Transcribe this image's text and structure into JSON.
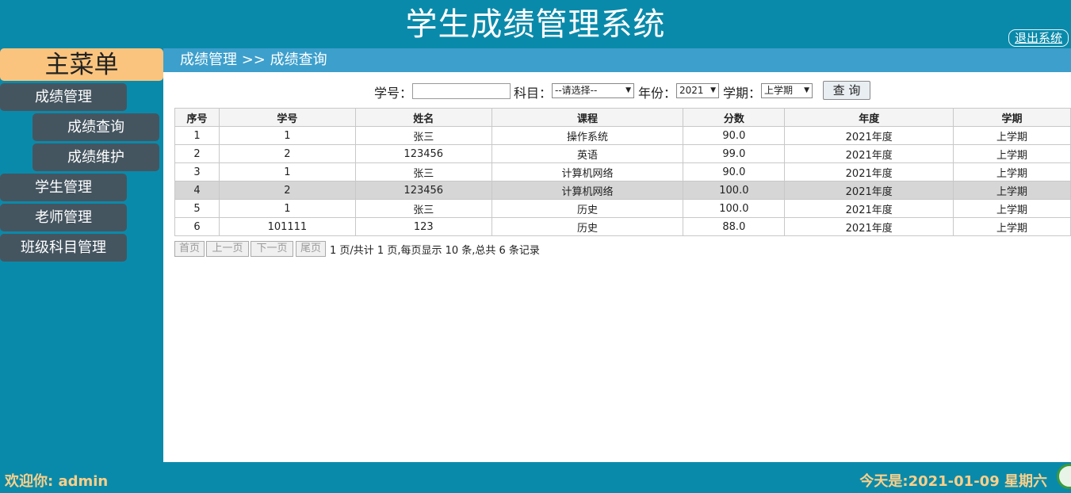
{
  "header": {
    "title": "学生成绩管理系统",
    "logout": "退出系统"
  },
  "sidebar": {
    "title": "主菜单",
    "items": [
      {
        "label": "成绩管理"
      },
      {
        "label": "成绩查询"
      },
      {
        "label": "成绩维护"
      },
      {
        "label": "学生管理"
      },
      {
        "label": "老师管理"
      },
      {
        "label": "班级科目管理"
      }
    ]
  },
  "breadcrumb": "成绩管理 >> 成绩查询",
  "search": {
    "student_no_label": "学号：",
    "student_no_value": "",
    "subject_label": "科目：",
    "subject_selected": "--请选择--",
    "year_label": "年份：",
    "year_selected": "2021",
    "term_label": "学期：",
    "term_selected": "上学期",
    "query_button": "查 询"
  },
  "table": {
    "headers": [
      "序号",
      "学号",
      "姓名",
      "课程",
      "分数",
      "年度",
      "学期"
    ],
    "rows": [
      [
        "1",
        "1",
        "张三",
        "操作系统",
        "90.0",
        "2021年度",
        "上学期"
      ],
      [
        "2",
        "2",
        "123456",
        "英语",
        "99.0",
        "2021年度",
        "上学期"
      ],
      [
        "3",
        "1",
        "张三",
        "计算机网络",
        "90.0",
        "2021年度",
        "上学期"
      ],
      [
        "4",
        "2",
        "123456",
        "计算机网络",
        "100.0",
        "2021年度",
        "上学期"
      ],
      [
        "5",
        "1",
        "张三",
        "历史",
        "100.0",
        "2021年度",
        "上学期"
      ],
      [
        "6",
        "101111",
        "123",
        "历史",
        "88.0",
        "2021年度",
        "上学期"
      ]
    ]
  },
  "pager": {
    "first": "首页",
    "prev": "上一页",
    "next": "下一页",
    "last": "尾页",
    "info": "1 页/共计 1 页,每页显示 10 条,总共 6 条记录"
  },
  "footer": {
    "welcome": "欢迎你: admin",
    "today": "今天是:2021-01-09 星期六"
  },
  "colors": {
    "background": "#0a8aaa",
    "menu_title": "#fbc47e",
    "menu_item": "#455560",
    "breadcrumb_bar": "#3d9fcc",
    "footer_text": "#fbd08a"
  }
}
